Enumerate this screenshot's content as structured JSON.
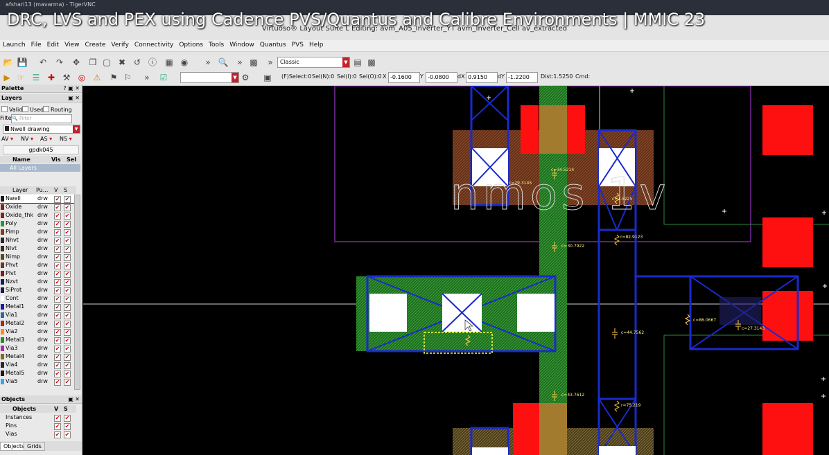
{
  "video": {
    "title": "DRC, LVS and PEX using Cadence PVS/Quantus and Calibre Environments | MMIC 23",
    "vnc_title": "afshari13 (mavarma) - TigerVNC"
  },
  "window": {
    "title": "Virtuoso® Layout Suite L Editing: avm_A05_Inverter_YT avm_Inverter_Cell av_extracted"
  },
  "menubar": [
    "Launch",
    "File",
    "Edit",
    "View",
    "Create",
    "Verify",
    "Connectivity",
    "Options",
    "Tools",
    "Window",
    "Quantus",
    "PVS",
    "Help"
  ],
  "toolbar": {
    "workspace": "Classic",
    "more1": "»",
    "more2": "»",
    "more3": "»",
    "more4": "»"
  },
  "statusbar": {
    "fselect": "(F)Select:0",
    "seln": "Sel(N):0",
    "seli": "Sel(I):0",
    "selo": "Sel(O):0",
    "x_label": "X",
    "x_value": "-0.1600",
    "y_label": "Y",
    "y_value": "-0.0800",
    "dx_label": "dX",
    "dx_value": "0.9150",
    "dy_label": "dY",
    "dy_value": "-1.2200",
    "dist": "Dist:1.5250",
    "cmd": "Cmd:"
  },
  "palette": {
    "title": "Palette",
    "layers_title": "Layers",
    "filters": [
      "Valid",
      "Used",
      "Routing"
    ],
    "filter_label": "Filter",
    "filter_placeholder": "Filter",
    "current_layer": "Nwell drawing",
    "vis_options": [
      "AV",
      "NV",
      "AS",
      "NS"
    ],
    "techlib": "gpdk045",
    "table_headers": {
      "name": "Name",
      "vis": "Vis",
      "sel": "Sel"
    },
    "all_layers": "All Layers",
    "list_headers": {
      "layer": "Layer",
      "purpose": "Pu...",
      "v": "V",
      "s": "S"
    },
    "layers": [
      {
        "name": "Nwell",
        "purpose": "drw",
        "color": "#1a1a1a"
      },
      {
        "name": "Oxide",
        "purpose": "drw",
        "color": "#8a2020"
      },
      {
        "name": "Oxide_thk",
        "purpose": "drw",
        "color": "#8a2020"
      },
      {
        "name": "Poly",
        "purpose": "drw",
        "color": "#2a9a2a"
      },
      {
        "name": "Pimp",
        "purpose": "drw",
        "color": "#8a3a1a"
      },
      {
        "name": "Nhvt",
        "purpose": "drw",
        "color": "#2a2a2a"
      },
      {
        "name": "Nlvt",
        "purpose": "drw",
        "color": "#3a2a2a"
      },
      {
        "name": "Nimp",
        "purpose": "drw",
        "color": "#5a4a1a"
      },
      {
        "name": "Phvt",
        "purpose": "drw",
        "color": "#6a3a1a"
      },
      {
        "name": "Plvt",
        "purpose": "drw",
        "color": "#8a1a1a"
      },
      {
        "name": "Nzvt",
        "purpose": "drw",
        "color": "#1a1a6a"
      },
      {
        "name": "SiProt",
        "purpose": "drw",
        "color": "#1a1a4a"
      },
      {
        "name": "Cont",
        "purpose": "drw",
        "color": "#ffffff"
      },
      {
        "name": "Metal1",
        "purpose": "drw",
        "color": "#1a1aaa"
      },
      {
        "name": "Via1",
        "purpose": "drw",
        "color": "#2a6aaa"
      },
      {
        "name": "Metal2",
        "purpose": "drw",
        "color": "#aa2a1a"
      },
      {
        "name": "Via2",
        "purpose": "drw",
        "color": "#ff8a1a"
      },
      {
        "name": "Metal3",
        "purpose": "drw",
        "color": "#2a8a2a"
      },
      {
        "name": "Via3",
        "purpose": "drw",
        "color": "#aa2aaa"
      },
      {
        "name": "Metal4",
        "purpose": "drw",
        "color": "#8a6a1a"
      },
      {
        "name": "Via4",
        "purpose": "drw",
        "color": "#2a2a2a"
      },
      {
        "name": "Metal5",
        "purpose": "drw",
        "color": "#1a1a1a"
      },
      {
        "name": "Via5",
        "purpose": "drw",
        "color": "#2aaaff"
      }
    ],
    "objects_title": "Objects",
    "objects_headers": {
      "name": "Objects",
      "v": "V",
      "s": "S"
    },
    "objects": [
      "Instances",
      "Pins",
      "Vias"
    ],
    "tabs": [
      "Objects",
      "Grids"
    ]
  },
  "canvas": {
    "label_text": "nmos 1v",
    "annotations": [
      {
        "text": "c=29.3145",
        "kind": "cap"
      },
      {
        "text": "c=34.5214",
        "kind": "cap"
      },
      {
        "text": "c=1.5225",
        "kind": "cap"
      },
      {
        "text": "r=82.9123",
        "kind": "res"
      },
      {
        "text": "c=30.7922",
        "kind": "cap"
      },
      {
        "text": "c=44.7562",
        "kind": "cap"
      },
      {
        "text": "c=86.0667",
        "kind": "cap"
      },
      {
        "text": "c=27.3143",
        "kind": "cap"
      },
      {
        "text": "c=43.7612",
        "kind": "cap"
      },
      {
        "text": "r=75.219",
        "kind": "res"
      }
    ],
    "colors": {
      "background": "#000000",
      "poly": "#2e8b2e",
      "metal1": "#1a2acc",
      "contact": "#ffffff",
      "pad": "#ff1010",
      "implant": "#a05020",
      "nwell": "#7a2a9a",
      "selection": "#ffff33"
    }
  }
}
